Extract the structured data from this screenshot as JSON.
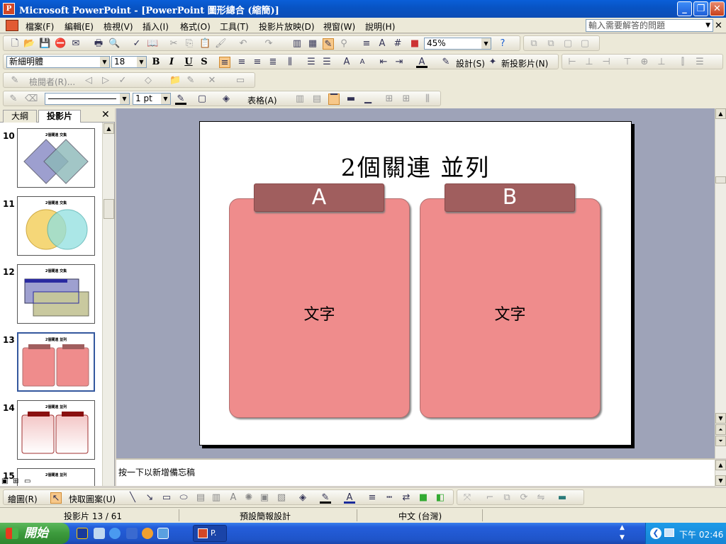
{
  "window": {
    "title": "Microsoft PowerPoint - [PowerPoint 圖形總合 (縮簡)]"
  },
  "menu": {
    "items": [
      "檔案(F)",
      "編輯(E)",
      "檢視(V)",
      "插入(I)",
      "格式(O)",
      "工具(T)",
      "投影片放映(D)",
      "視窗(W)",
      "說明(H)"
    ],
    "help_placeholder": "輸入需要解答的問題"
  },
  "toolbar_standard": {
    "zoom": "45%"
  },
  "toolbar_formatting": {
    "font": "新細明體",
    "size": "18",
    "design_label": "設計(S)",
    "new_slide_label": "新投影片(N)"
  },
  "toolbar_reviewing": {
    "reviewer_label": "檢閱者(R)..."
  },
  "toolbar_tables": {
    "line_weight": "1 pt",
    "table_label": "表格(A)"
  },
  "left_pane": {
    "tabs": [
      "大綱",
      "投影片"
    ],
    "active_tab": "投影片",
    "thumbnails": [
      {
        "num": "10",
        "title": "2個關連  交集"
      },
      {
        "num": "11",
        "title": "2個關連  交集"
      },
      {
        "num": "12",
        "title": "2個關連  交集"
      },
      {
        "num": "13",
        "title": "2個關連  並列"
      },
      {
        "num": "14",
        "title": "2個關連  並列"
      },
      {
        "num": "15",
        "title": "2個關連  並列"
      }
    ]
  },
  "slide": {
    "title": "2個關連  並列",
    "cards": [
      {
        "header": "A",
        "text": "文字"
      },
      {
        "header": "B",
        "text": "文字"
      }
    ]
  },
  "notes": {
    "placeholder": "按一下以新增備忘稿"
  },
  "drawing_toolbar": {
    "draw_label": "繪圖(R)",
    "autoshapes_label": "快取圖案(U)"
  },
  "status": {
    "slide_pos": "投影片 13 / 61",
    "design": "預設簡報設計",
    "language": "中文 (台灣)"
  },
  "taskbar": {
    "start_label": "開始",
    "task_label": "P.",
    "clock": "下午 02:46"
  },
  "colors": {
    "card_fill": "#ef8c8c",
    "card_header": "#a05e5e",
    "slide_area_bg": "#9ea3b8"
  }
}
